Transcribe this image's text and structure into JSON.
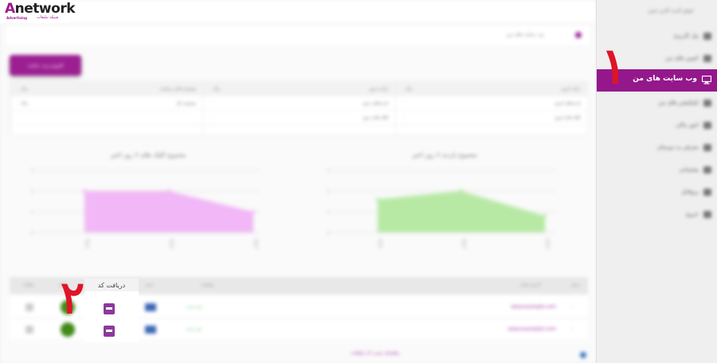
{
  "logo": {
    "brand_a": "A",
    "brand_rest": "network",
    "sub_en": "Advertising",
    "sub_fa": "شبکه تبلیغات"
  },
  "sidebar": {
    "user": "خوش آمدید کاربر عزیز",
    "items": [
      {
        "label": "پنل کاربری"
      },
      {
        "label": "کمپین های من"
      },
      {
        "label": "وب سایت های من",
        "active": true
      },
      {
        "label": "اپلیکیشن های من"
      },
      {
        "label": "امور مالی"
      },
      {
        "label": "معرفی به دوستان"
      },
      {
        "label": "پشتیبانی"
      },
      {
        "label": "پروفایل"
      },
      {
        "label": "خروج"
      }
    ]
  },
  "content": {
    "breadcrumb": "وب سایت های من",
    "add_button": "افزودن وب سایت",
    "stats": {
      "columns": [
        {
          "head_right": "درآمد امروز",
          "head_left": "۰ ریال",
          "rows": [
            [
              "بازدیدهای امروز",
              "۰"
            ],
            [
              "کلیک های امروز",
              "۰"
            ]
          ]
        },
        {
          "head_right": "درآمد دیروز",
          "head_left": "۰ ریال",
          "rows": [
            [
              "بازدیدهای دیروز",
              "۰"
            ],
            [
              "کلیک های دیروز",
              "۰"
            ]
          ]
        },
        {
          "head_right": "موجودی قابل برداشت",
          "head_left": "۰ ریال",
          "rows": [
            [
              "موجودی کل",
              "۰ ریال"
            ],
            [
              "",
              ""
            ]
          ]
        }
      ]
    },
    "charts": [
      {
        "title": "مجموع کلیک های ۷ روز اخیر"
      },
      {
        "title": "مجموع بازدید ۷ روز اخیر"
      }
    ],
    "table": {
      "headers": [
        "ردیف",
        "آدرس سایت",
        "وضعیت",
        "دسته",
        "کد",
        "درآمد",
        "عملیات"
      ],
      "rows": [
        {
          "url": "www.example.com",
          "status": "تایید شده"
        },
        {
          "url": "www.example2.com",
          "status": "تایید شده"
        }
      ]
    },
    "footer_link": "راهنمای نصب کد تبلیغات"
  },
  "tooltip": "دریافت کد",
  "annotations": {
    "one": "۱",
    "two": "۲"
  },
  "chart_data": [
    {
      "type": "area",
      "title": "مجموع کلیک های ۷ روز اخیر",
      "x": [
        "day1",
        "day2",
        "day3"
      ],
      "series": [
        {
          "values": [
            2,
            2,
            1
          ]
        }
      ],
      "ylim": [
        0,
        3
      ],
      "color": "#f0b3f5"
    },
    {
      "type": "area",
      "title": "مجموع بازدید ۷ روز اخیر",
      "x": [
        "day1",
        "day2",
        "day3"
      ],
      "series": [
        {
          "values": [
            1.6,
            2,
            0.8
          ]
        }
      ],
      "ylim": [
        0,
        3
      ],
      "color": "#b3e8a0"
    }
  ],
  "colors": {
    "brand": "#94188c",
    "annot": "#e01427",
    "chart_pink": "#f0b3f5",
    "chart_green": "#b3e8a0"
  }
}
